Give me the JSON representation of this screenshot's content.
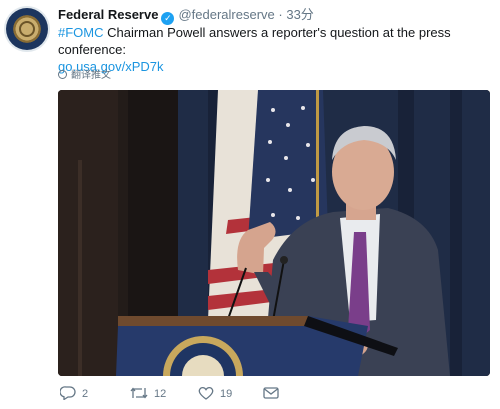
{
  "tweet": {
    "author_name": "Federal Reserve",
    "handle": "@federalreserve",
    "separator": "·",
    "time": "33分",
    "hashtag": "#FOMC",
    "text": " Chairman Powell answers a reporter's question at the press conference:",
    "link": "go.usa.gov/xPD7k",
    "translate_label": "翻译推文"
  },
  "actions": {
    "reply_count": "2",
    "retweet_count": "12",
    "like_count": "19"
  },
  "icons": {
    "avatar": "federal-reserve-seal",
    "verified": "verified-badge",
    "translate": "globe-icon",
    "reply": "reply-icon",
    "retweet": "retweet-icon",
    "like": "heart-icon",
    "dm": "envelope-icon"
  },
  "colors": {
    "link": "#1b95e0",
    "verified": "#1da1f2",
    "secondary_text": "#657786"
  }
}
